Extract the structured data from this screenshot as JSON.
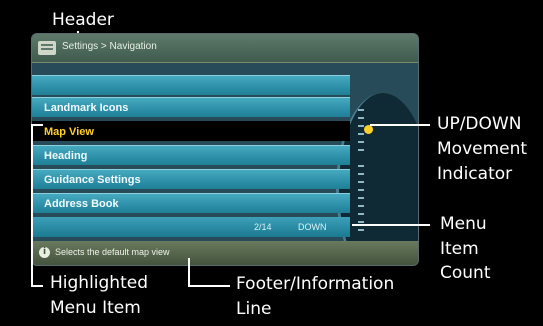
{
  "callouts": {
    "header": "Header",
    "updown_1": "UP/DOWN",
    "updown_2": "Movement",
    "updown_3": "Indicator",
    "count_1": "Menu",
    "count_2": "Item",
    "count_3": "Count",
    "highlighted_1": "Highlighted",
    "highlighted_2": "Menu Item",
    "footer_1": "Footer/Information",
    "footer_2": "Line"
  },
  "screen": {
    "header_title": "Settings > Navigation",
    "menu_items": [
      "Landmark Icons",
      "Map View",
      "Heading",
      "Guidance Settings",
      "Address Book"
    ],
    "count": "2/14",
    "count_direction": "DOWN",
    "footer_text": "Selects the default map view",
    "info_icon": "info-icon"
  },
  "colors": {
    "highlight_text": "#ffd02a",
    "row_blue": "#2f93ab",
    "indicator": "#ffd02a"
  }
}
